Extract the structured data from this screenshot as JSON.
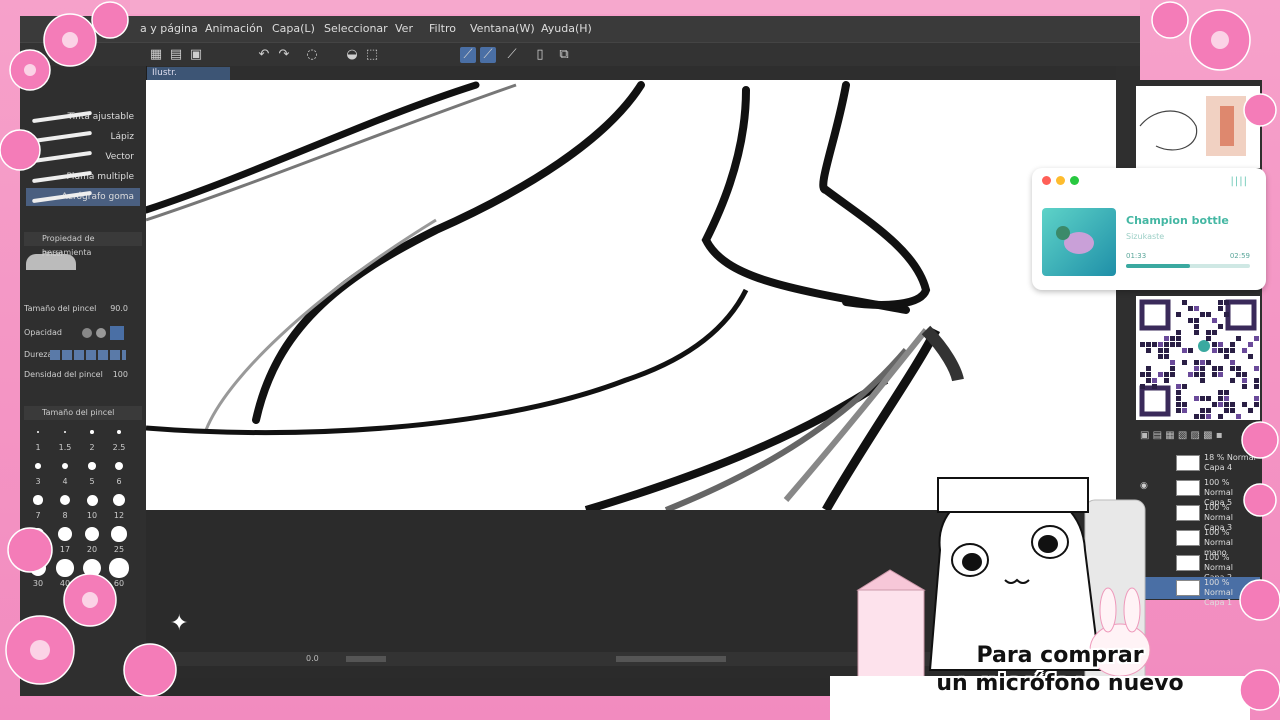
{
  "menu": [
    "a y página",
    "Animación",
    "Capa(L)",
    "Seleccionar",
    "Ver",
    "Filtro",
    "Ventana(W)",
    "Ayuda(H)"
  ],
  "canvas_tab": "Ilustr.",
  "brushes": [
    "Tinta ajustable",
    "Lápiz",
    "Vector",
    "Pluma multiple",
    "Aerógrafo goma"
  ],
  "tool_property": {
    "title": "Propiedad de herramienta",
    "brush_name": "Pincel",
    "rows": [
      {
        "label": "Tamaño del pincel",
        "value": "90.0"
      },
      {
        "label": "Opacidad",
        "value": ""
      },
      {
        "label": "Dureza",
        "value": ""
      },
      {
        "label": "Densidad del pincel",
        "value": "100"
      }
    ]
  },
  "brush_size_panel": {
    "title": "Tamaño del pincel",
    "sizes": [
      "1",
      "1.5",
      "2",
      "2.5",
      "3",
      "4",
      "5",
      "6",
      "7",
      "8",
      "10",
      "12",
      "15",
      "17",
      "20",
      "25",
      "30",
      "40",
      "50",
      "60"
    ]
  },
  "status_bar": {
    "zoom": "0.0"
  },
  "layers": [
    {
      "blend": "18 % Normal",
      "name": "Capa 4"
    },
    {
      "blend": "100 % Normal",
      "name": "Capa 5"
    },
    {
      "blend": "100 % Normal",
      "name": "Capa 3"
    },
    {
      "blend": "100 % Normal",
      "name": "mano"
    },
    {
      "blend": "100 % Normal",
      "name": "Capa 2"
    },
    {
      "blend": "100 % Normal",
      "name": "Capa 1"
    }
  ],
  "music_player": {
    "song": "Champion bottle",
    "artist": "Sizukaste",
    "time_elapsed": "01:33",
    "time_total": "02:59",
    "progress_fraction": 0.52,
    "accent": "#44b7a3"
  },
  "caption": {
    "line1": "Para comprar",
    "line2": "un micrófono nuevo"
  },
  "colors": {
    "frame_pink": "#f6a1ca",
    "app_dark": "#2a2a2a",
    "selection_blue": "#4a6fa5"
  }
}
